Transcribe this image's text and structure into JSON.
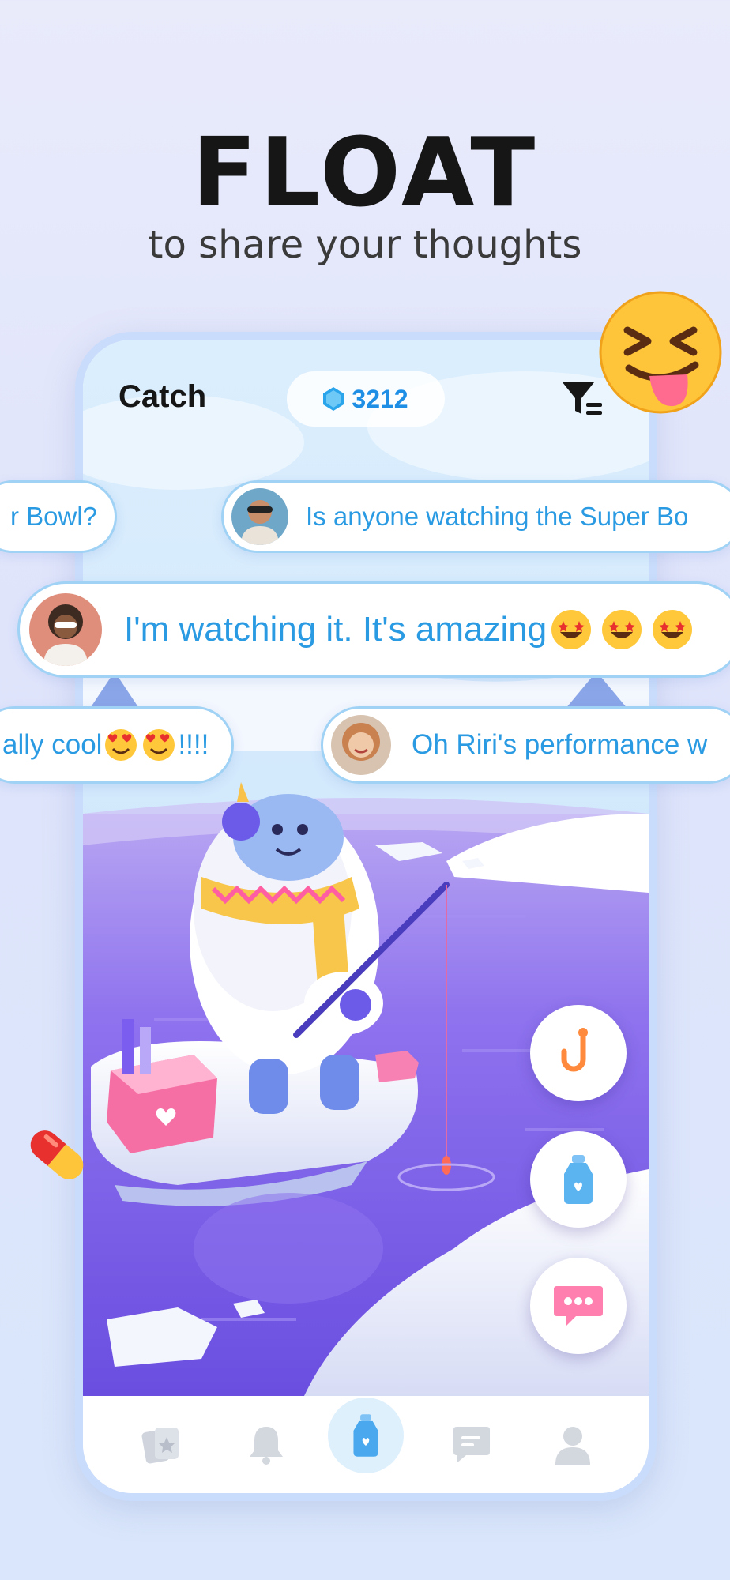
{
  "header": {
    "title": "FLOAT",
    "subtitle": "to share your thoughts"
  },
  "app": {
    "screen_title": "Catch",
    "coin_count": "3212",
    "filter_icon": "filter-icon"
  },
  "bubbles": [
    {
      "text": "r Bowl?",
      "avatar": false
    },
    {
      "text": "Is anyone watching the Super Bo",
      "avatar": true
    },
    {
      "text": "I'm watching it. It's amazing",
      "emoji_count": 3,
      "avatar": true
    },
    {
      "text": "ally cool",
      "trail": "!!!!",
      "emoji_count": 2,
      "avatar": false
    },
    {
      "text": "Oh Riri's performance w",
      "avatar": true
    }
  ],
  "actions": [
    {
      "name": "hook-icon"
    },
    {
      "name": "bottle-icon"
    },
    {
      "name": "chat-icon"
    }
  ],
  "tabs": [
    {
      "name": "cards-icon"
    },
    {
      "name": "bell-icon"
    },
    {
      "name": "bottle-icon",
      "active": true
    },
    {
      "name": "message-icon"
    },
    {
      "name": "profile-icon"
    }
  ],
  "colors": {
    "accent": "#1f8fe6",
    "bubble_text": "#2a9be3",
    "bubble_border": "#9fd2f5",
    "lake": "#7a5fe6"
  }
}
